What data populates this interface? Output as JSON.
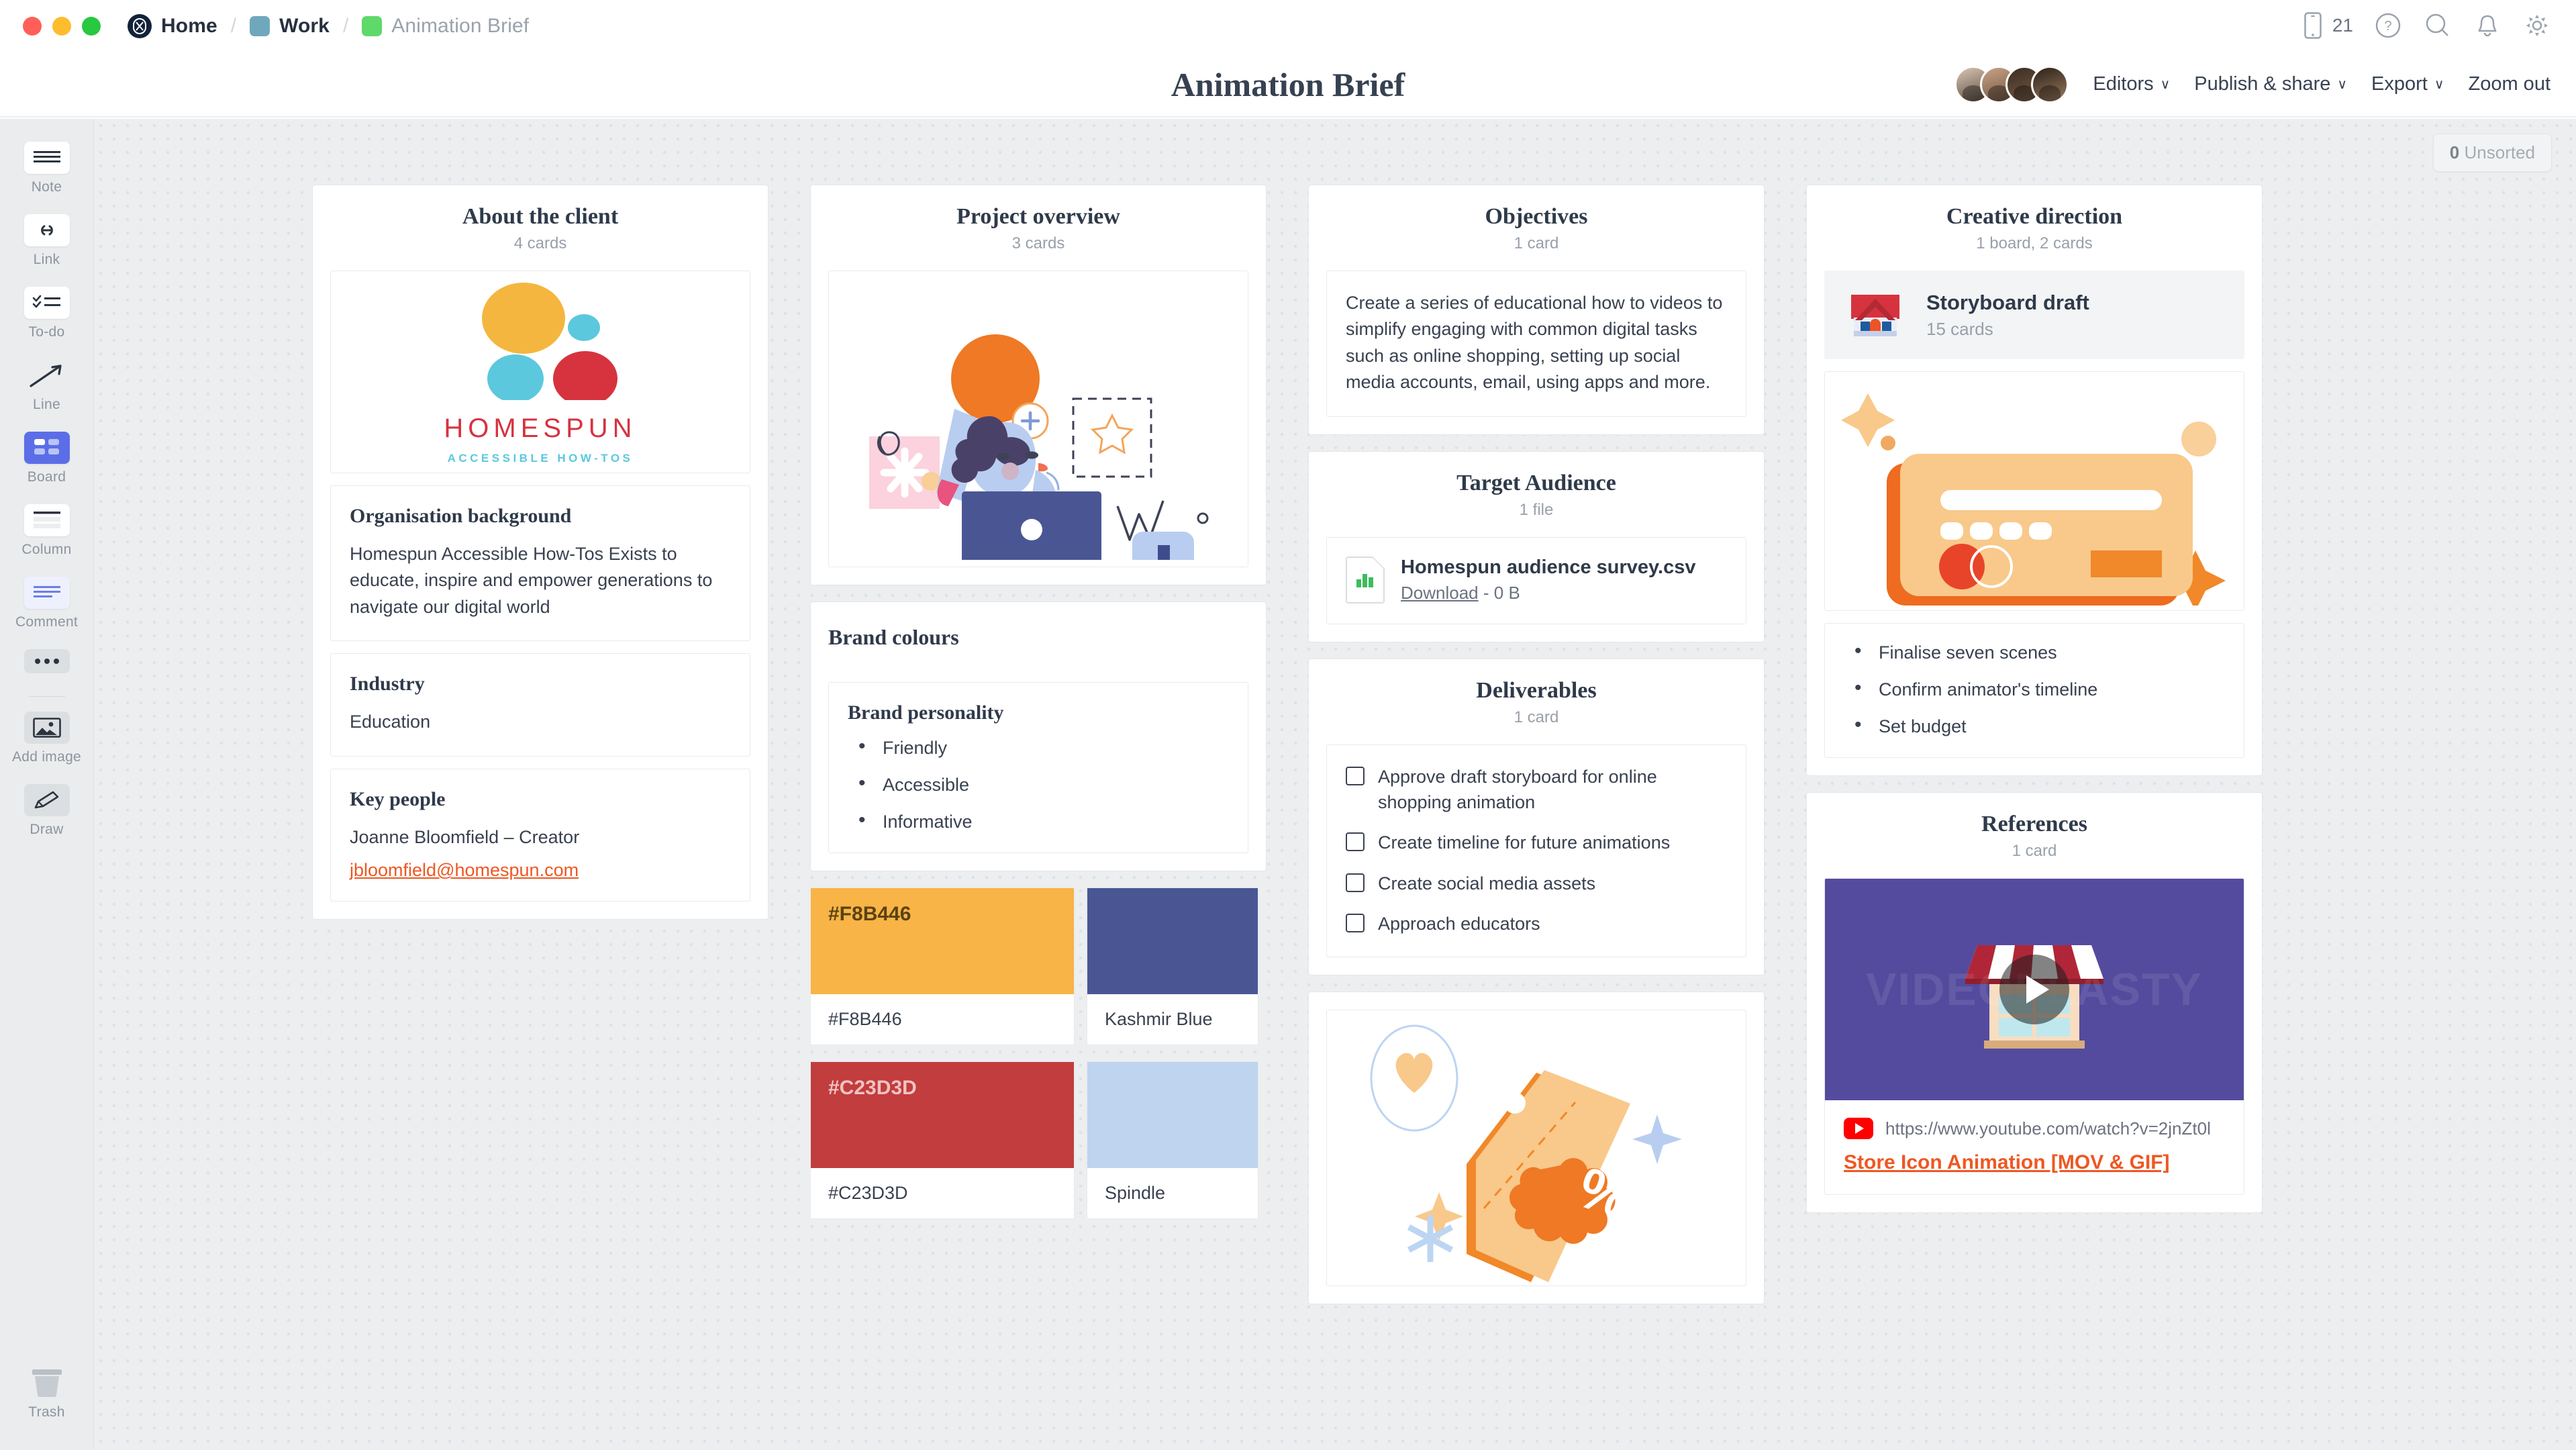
{
  "titlebar": {
    "breadcrumbs": [
      {
        "label": "Home",
        "icon": "milanote-logo-icon",
        "muted": false
      },
      {
        "label": "Work",
        "icon": "blue-square-icon",
        "muted": false
      },
      {
        "label": "Animation Brief",
        "icon": "green-square-icon",
        "muted": true
      }
    ],
    "separator": "/",
    "phone_count": "21",
    "icons": [
      "phone-icon",
      "help-icon",
      "search-icon",
      "bell-icon",
      "gear-icon"
    ]
  },
  "header": {
    "title": "Animation Brief",
    "buttons": [
      {
        "label": "Editors",
        "caret": "∨"
      },
      {
        "label": "Publish & share",
        "caret": "∨"
      },
      {
        "label": "Export",
        "caret": "∨"
      },
      {
        "label": "Zoom out",
        "caret": ""
      }
    ]
  },
  "toolbar": {
    "items": [
      {
        "label": "Note",
        "icon": "note-icon"
      },
      {
        "label": "Link",
        "icon": "link-icon"
      },
      {
        "label": "To-do",
        "icon": "todo-icon"
      },
      {
        "label": "Line",
        "icon": "line-arrow-icon"
      },
      {
        "label": "Board",
        "icon": "board-icon"
      },
      {
        "label": "Column",
        "icon": "column-icon"
      },
      {
        "label": "Comment",
        "icon": "comment-icon"
      },
      {
        "label": "",
        "icon": "more-dots-icon"
      },
      {
        "label": "Add image",
        "icon": "add-image-icon"
      },
      {
        "label": "Draw",
        "icon": "draw-pencil-icon"
      }
    ],
    "trash": {
      "label": "Trash",
      "icon": "trash-icon"
    }
  },
  "canvas": {
    "unsorted_count": "0",
    "unsorted_label": "Unsorted"
  },
  "columns": [
    {
      "id": "about-the-client",
      "title": "About the client",
      "subtitle": "4 cards",
      "cards": [
        {
          "type": "image",
          "name": "homespun-logo",
          "wordmark": "HOMESPUN",
          "tagline": "ACCESSIBLE HOW-TOS"
        },
        {
          "type": "text",
          "title": "Organisation background",
          "body": "Homespun Accessible How-Tos Exists to educate, inspire and empower generations to navigate our digital world"
        },
        {
          "type": "text",
          "title": "Industry",
          "body": "Education"
        },
        {
          "type": "people",
          "title": "Key people",
          "body": "Joanne Bloomfield – Creator",
          "email": "jbloomfield@homespun.com"
        }
      ]
    },
    {
      "id": "project-overview",
      "title": "Project overview",
      "subtitle": "3 cards",
      "cards": [
        {
          "type": "image",
          "name": "woman-at-laptop-illustration"
        },
        {
          "type": "heading",
          "title": "Brand colours"
        },
        {
          "type": "bullets",
          "title": "Brand personality",
          "items": [
            "Friendly",
            "Accessible",
            "Informative"
          ]
        }
      ],
      "swatches": [
        {
          "hex": "#F8B446",
          "on_chip_label": "#F8B446",
          "on_chip_color": "#5b4312",
          "caption": "#F8B446"
        },
        {
          "hex": "#4A5694",
          "on_chip_label": "",
          "on_chip_color": "#ffffff",
          "caption": "Kashmir Blue"
        },
        {
          "hex": "#C23D3D",
          "on_chip_label": "#C23D3D",
          "on_chip_color": "#f0c3c3",
          "caption": "#C23D3D"
        },
        {
          "hex": "#BED4EF",
          "on_chip_label": "",
          "on_chip_color": "#33415c",
          "caption": "Spindle"
        }
      ]
    },
    {
      "id": "objectives",
      "title": "Objectives",
      "subtitle": "1 card",
      "body": "Create a series of educational how to videos to simplify engaging with common digital tasks such as online shopping, setting up social media accounts, email, using apps and more."
    },
    {
      "id": "target-audience",
      "title": "Target Audience",
      "subtitle": "1 file",
      "file": {
        "name": "Homespun audience survey.csv",
        "download_label": "Download",
        "size": "- 0 B",
        "icon": "csv-chart-file-icon"
      }
    },
    {
      "id": "deliverables",
      "title": "Deliverables",
      "subtitle": "1 card",
      "checklist": [
        {
          "label": "Approve draft storyboard for online shopping animation",
          "checked": false
        },
        {
          "label": "Create timeline for future animations",
          "checked": false
        },
        {
          "label": "Create social media assets",
          "checked": false
        },
        {
          "label": "Approach educators",
          "checked": false
        }
      ]
    },
    {
      "id": "price-tag-card",
      "type": "image",
      "name": "price-tag-percent-illustration"
    },
    {
      "id": "creative-direction",
      "title": "Creative direction",
      "subtitle": "1 board, 2 cards",
      "board": {
        "name": "Storyboard draft",
        "sub": "15 cards",
        "icon": "house-board-icon"
      },
      "bullets": [
        "Finalise seven scenes",
        "Confirm animator's timeline",
        "Set budget"
      ]
    },
    {
      "id": "references",
      "title": "References",
      "subtitle": "1 card",
      "video": {
        "watermark": "VIDEOPLASTY",
        "url": "https://www.youtube.com/watch?v=2jnZt0l",
        "title": "Store Icon Animation [MOV & GIF]",
        "thumb_bg": "#544b9e"
      }
    }
  ]
}
